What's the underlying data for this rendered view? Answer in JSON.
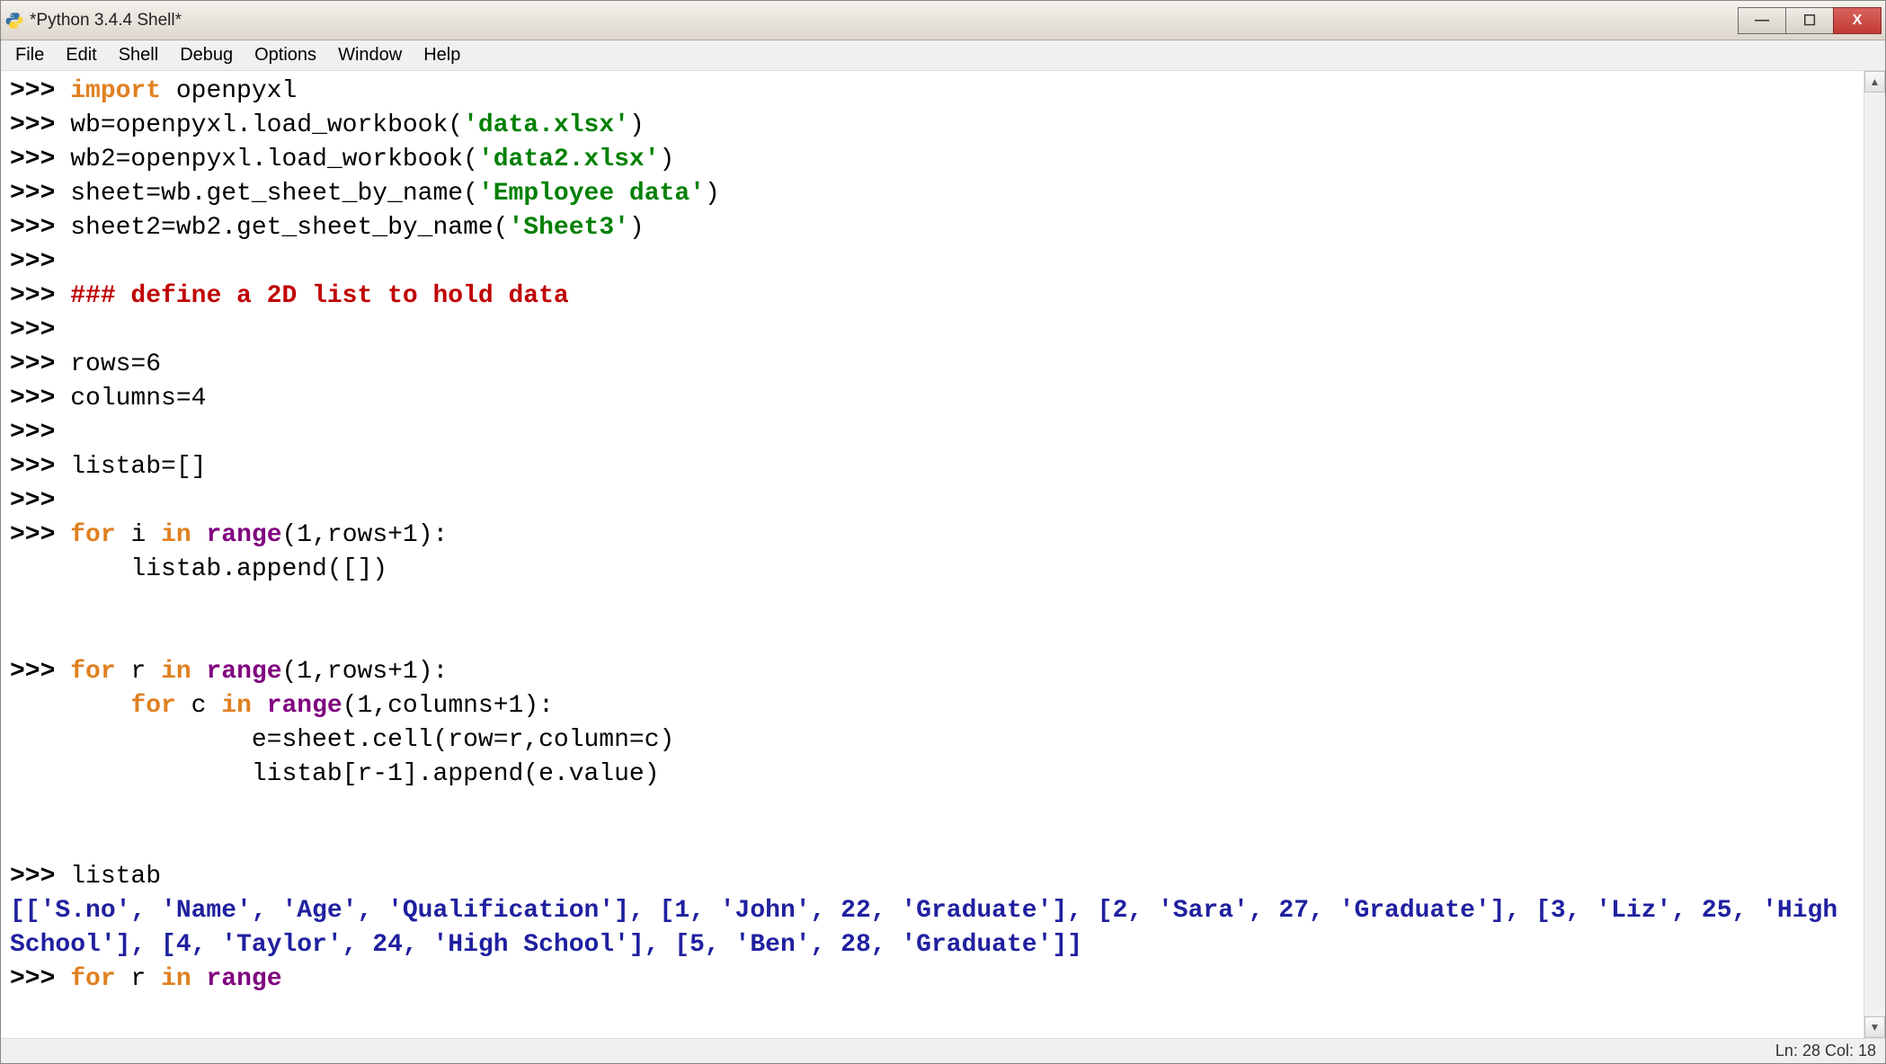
{
  "window": {
    "title": "*Python 3.4.4 Shell*",
    "controls": {
      "min": "—",
      "max": "☐",
      "close": "X"
    }
  },
  "menubar": {
    "items": [
      "File",
      "Edit",
      "Shell",
      "Debug",
      "Options",
      "Window",
      "Help"
    ]
  },
  "shell": {
    "prompt": ">>> ",
    "cont_indent1": "        ",
    "cont_indent2": "                ",
    "cont_indent3": "                ",
    "kw_import": "import",
    "kw_for": "for",
    "kw_in": "in",
    "builtin_range": "range",
    "l1_rest": " openpyxl",
    "l2_pre": "wb=openpyxl.load_workbook(",
    "l2_str": "'data.xlsx'",
    "l2_post": ")",
    "l3_pre": "wb2=openpyxl.load_workbook(",
    "l3_str": "'data2.xlsx'",
    "l3_post": ")",
    "l4_pre": "sheet=wb.get_sheet_by_name(",
    "l4_str": "'Employee data'",
    "l4_post": ")",
    "l5_pre": "sheet2=wb2.get_sheet_by_name(",
    "l5_str": "'Sheet3'",
    "l5_post": ")",
    "comment": "### define a 2D list to hold data",
    "rows": "rows=6",
    "columns": "columns=4",
    "listab_init": "listab=[]",
    "for1_mid": " i ",
    "for1_args": "(1,rows+1):",
    "for1_body": "listab.append([])",
    "for2_mid": " r ",
    "for2_args": "(1,rows+1):",
    "for2_inner_mid": " c ",
    "for2_inner_args": "(1,columns+1):",
    "for2_body1": "e=sheet.cell(row=r,column=c)",
    "for2_body2": "listab[r-1].append(e.value)",
    "listab_call": "listab",
    "output": "[['S.no', 'Name', 'Age', 'Qualification'], [1, 'John', 22, 'Graduate'], [2, 'Sara', 27, 'Graduate'], [3, 'Liz', 25, 'High School'], [4, 'Taylor', 24, 'High School'], [5, 'Ben', 28, 'Graduate']]",
    "for3_mid": " r "
  },
  "status": {
    "text": "Ln: 28  Col: 18"
  },
  "scroll": {
    "up": "▲",
    "down": "▼"
  }
}
